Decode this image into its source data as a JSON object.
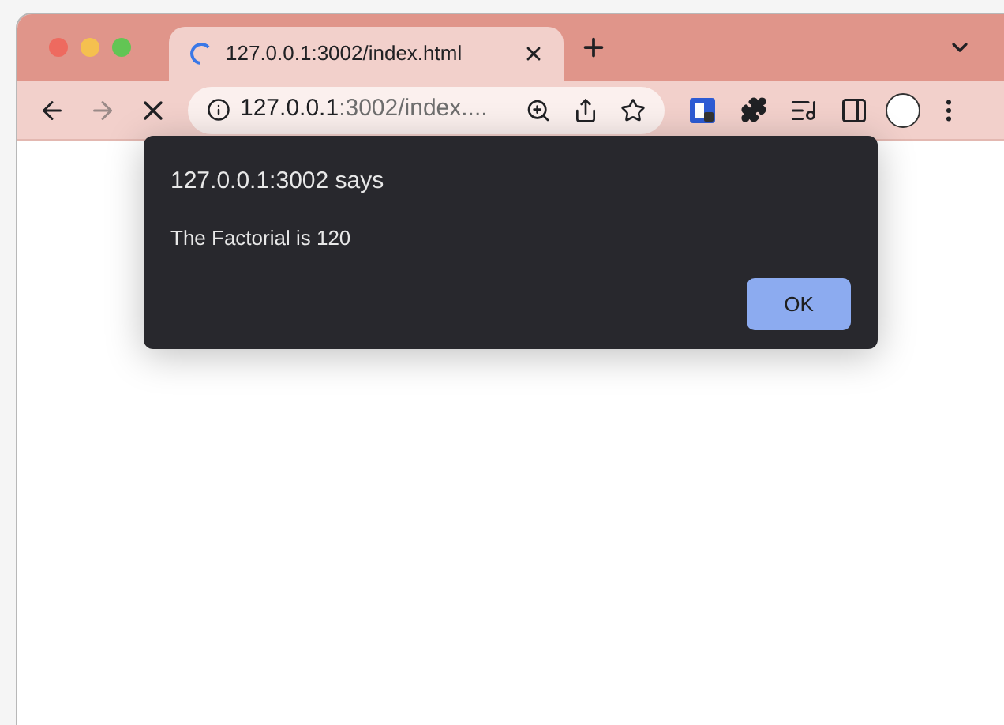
{
  "tabs": [
    {
      "title": "127.0.0.1:3002/index.html",
      "selected": true,
      "loading": true
    }
  ],
  "address_bar": {
    "host": "127.0.0.1",
    "rest": ":3002/index...."
  },
  "dialog": {
    "title": "127.0.0.1:3002 says",
    "message": "The Factorial is 120",
    "button": "OK"
  }
}
